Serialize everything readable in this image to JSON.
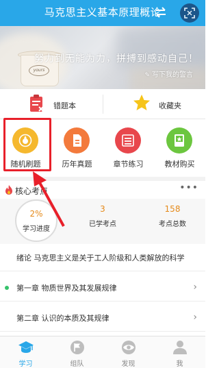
{
  "header": {
    "title": "马克思主义基本原理概论",
    "swap_icon": "swap-arrows-icon",
    "scan_icon": "scan-icon"
  },
  "banner": {
    "slogan": "努力到无能为力，拼搏到感动自己！",
    "link_label": "写下我的警言",
    "cup_logo": "yours"
  },
  "quick": {
    "wrong_book": "错题本",
    "favorites": "收藏夹"
  },
  "grid": [
    {
      "label": "随机刷题",
      "color": "#f5b82e",
      "icon": "random-practice-icon"
    },
    {
      "label": "历年真题",
      "color": "#f37a3c",
      "icon": "past-papers-icon"
    },
    {
      "label": "章节练习",
      "color": "#e8474c",
      "icon": "chapter-practice-icon"
    },
    {
      "label": "教材购买",
      "color": "#6cc63f",
      "icon": "textbook-icon"
    }
  ],
  "core": {
    "title": "核心考点",
    "more": "•••"
  },
  "stats": {
    "progress_value": "2%",
    "progress_label": "学习进度",
    "learned_value": "3",
    "learned_label": "已学考点",
    "total_value": "158",
    "total_label": "考点总数"
  },
  "list": [
    {
      "text": "绪论 马克思主义是关于工人阶级和人类解放的科学"
    },
    {
      "text": "第一章 物质世界及其发展规律"
    },
    {
      "text": "第二章 认识的本质及其规律"
    }
  ],
  "tabs": [
    {
      "label": "学习"
    },
    {
      "label": "组队"
    },
    {
      "label": "发现"
    },
    {
      "label": "我"
    }
  ],
  "colors": {
    "primary": "#29a7e8",
    "highlight": "#e8202a",
    "accent_orange": "#e58a1a"
  }
}
